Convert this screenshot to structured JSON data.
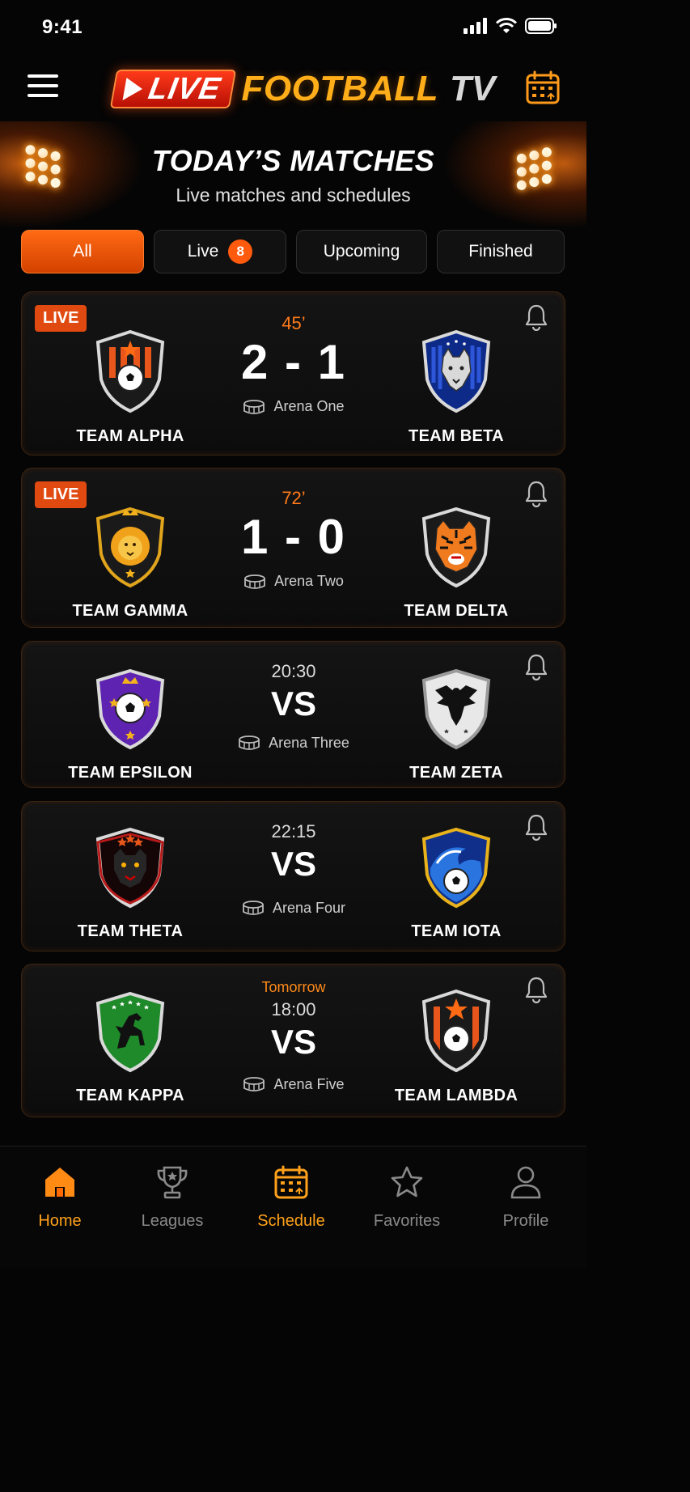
{
  "status": {
    "time": "9:41"
  },
  "header": {
    "logo": {
      "live": "LIVE",
      "football": "FOOTBALL",
      "tv": "TV"
    }
  },
  "hero": {
    "title": "TODAY’S MATCHES",
    "subtitle": "Live matches and schedules"
  },
  "filters": [
    {
      "label": "All",
      "active": true
    },
    {
      "label": "Live",
      "badge": "8"
    },
    {
      "label": "Upcoming"
    },
    {
      "label": "Finished"
    }
  ],
  "matches": [
    {
      "status": "LIVE",
      "minute": "45’",
      "score": "2 - 1",
      "home": "TEAM ALPHA",
      "away": "TEAM BETA",
      "venue": "Arena One"
    },
    {
      "status": "LIVE",
      "minute": "72’",
      "score": "1 - 0",
      "home": "TEAM GAMMA",
      "away": "TEAM DELTA",
      "venue": "Arena Two"
    },
    {
      "time": "20:30",
      "vs": "VS",
      "home": "TEAM EPSILON",
      "away": "TEAM ZETA",
      "venue": "Arena Three"
    },
    {
      "time": "22:15",
      "vs": "VS",
      "home": "TEAM THETA",
      "away": "TEAM IOTA",
      "venue": "Arena Four"
    },
    {
      "day": "Tomorrow",
      "time": "18:00",
      "vs": "VS",
      "home": "TEAM KAPPA",
      "away": "TEAM LAMBDA",
      "venue": "Arena Five"
    }
  ],
  "tabbar": [
    {
      "label": "Home",
      "icon": "home-icon",
      "active": true
    },
    {
      "label": "Leagues",
      "icon": "trophy-icon"
    },
    {
      "label": "Schedule",
      "icon": "calendar-icon",
      "active": true
    },
    {
      "label": "Favorites",
      "icon": "star-icon"
    },
    {
      "label": "Profile",
      "icon": "user-icon"
    }
  ],
  "colors": {
    "accent": "#ff6a14",
    "brand_gold": "#ffae1a",
    "live_red": "#e04a10",
    "background": "#050505"
  }
}
